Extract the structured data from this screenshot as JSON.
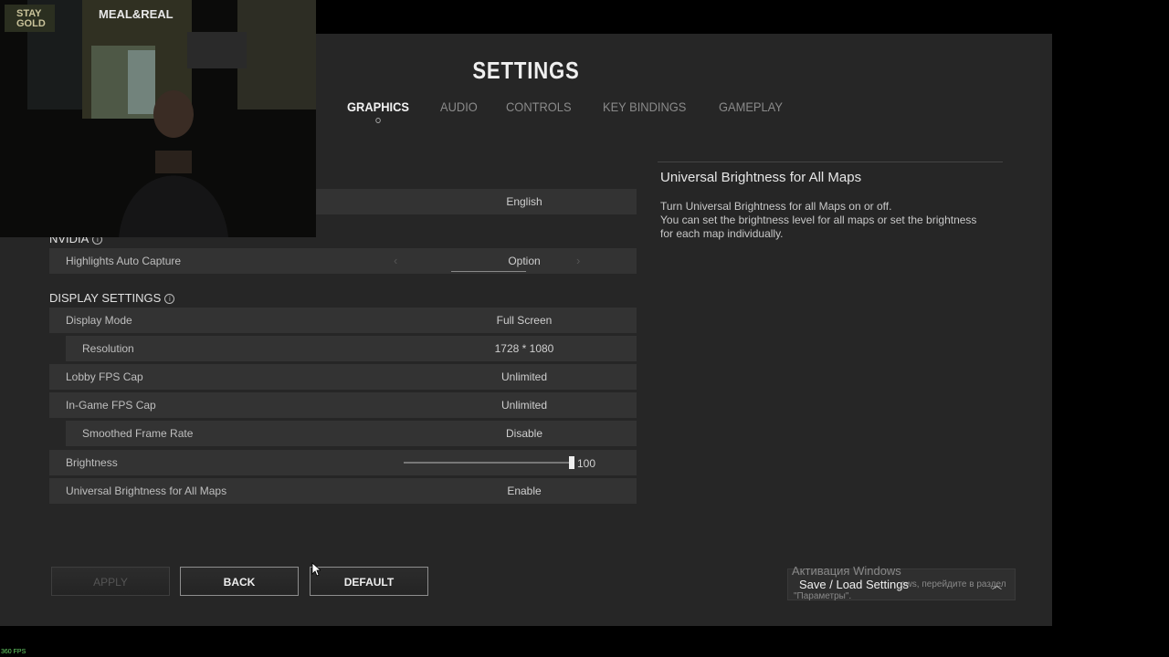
{
  "title": "SETTINGS",
  "tabs": [
    "GRAPHICS",
    "AUDIO",
    "CONTROLS",
    "KEY BINDINGS",
    "GAMEPLAY"
  ],
  "active_tab": "GRAPHICS",
  "language_row": {
    "value": "English"
  },
  "nvidia": {
    "section_title": "NVIDIA",
    "highlights": {
      "label": "Highlights Auto Capture",
      "value": "Option"
    }
  },
  "display": {
    "section_title": "DISPLAY SETTINGS",
    "rows": [
      {
        "label": "Display Mode",
        "value": "Full Screen"
      },
      {
        "label": "Resolution",
        "value": "1728 * 1080"
      },
      {
        "label": "Lobby FPS Cap",
        "value": "Unlimited"
      },
      {
        "label": "In-Game FPS Cap",
        "value": "Unlimited"
      },
      {
        "label": "Smoothed Frame Rate",
        "value": "Disable"
      },
      {
        "label": "Brightness",
        "value": "100"
      },
      {
        "label": "Universal Brightness for All Maps",
        "value": "Enable"
      }
    ],
    "brightness_level": 1.0
  },
  "detail": {
    "title": "Universal Brightness for All Maps",
    "body_line1": "Turn Universal Brightness for all Maps on or off.",
    "body_line2": "You can set the brightness level for all maps or set the brightness for each map individually."
  },
  "buttons": {
    "apply": "APPLY",
    "back": "BACK",
    "default": "DEFAULT"
  },
  "save_load": {
    "label": "Save / Load Settings"
  },
  "watermark": {
    "title": "Активация Windows",
    "line2": "ows, перейдите в раздел",
    "line3": "\"Параметры\"."
  },
  "webcam": {
    "sign_left": "STAY GOLD",
    "sign_center": "MEAL&REAL"
  },
  "fps_counter": "360 FPS",
  "colors": {
    "panel": "#262626",
    "row": "#333333",
    "active_tab": "#f2f2f2",
    "inactive_tab": "#8a8a8a"
  }
}
